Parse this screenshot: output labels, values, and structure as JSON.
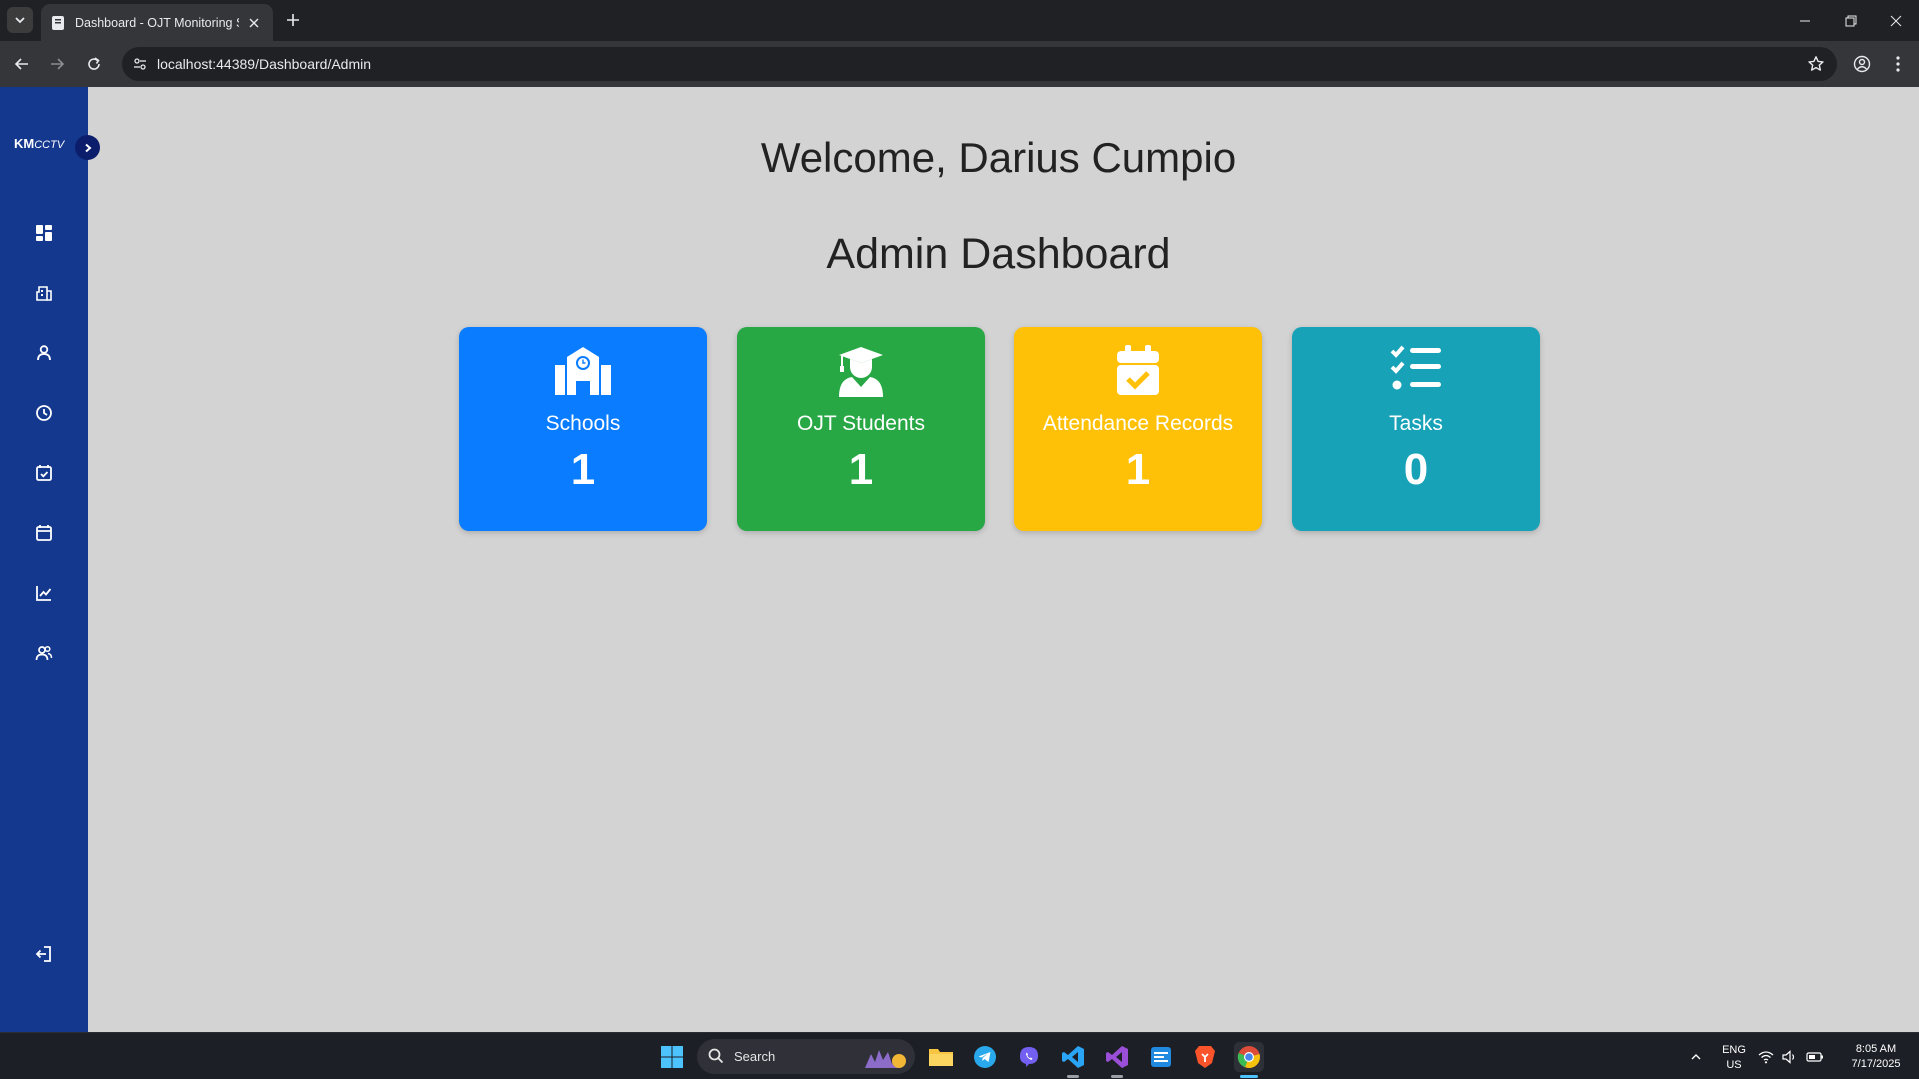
{
  "browser": {
    "tab_title": "Dashboard - OJT Monitoring Sy",
    "url": "localhost:44389/Dashboard/Admin"
  },
  "sidebar": {
    "logo_bold": "KM",
    "logo_italic": "CCTV",
    "items": [
      {
        "icon": "grid-dashboard-icon"
      },
      {
        "icon": "school-building-icon"
      },
      {
        "icon": "user-icon"
      },
      {
        "icon": "clock-icon"
      },
      {
        "icon": "calendar-check-icon"
      },
      {
        "icon": "calendar-icon"
      },
      {
        "icon": "line-chart-icon"
      },
      {
        "icon": "users-icon"
      }
    ],
    "logout_icon": "logout-icon"
  },
  "main": {
    "welcome": "Welcome, Darius Cumpio",
    "title": "Admin Dashboard"
  },
  "cards": [
    {
      "label": "Schools",
      "value": "1",
      "color": "#0a7cff",
      "icon": "school-icon"
    },
    {
      "label": "OJT Students",
      "value": "1",
      "color": "#28a745",
      "icon": "graduate-icon"
    },
    {
      "label": "Attendance Records",
      "value": "1",
      "color": "#ffc107",
      "icon": "calendar-check-icon"
    },
    {
      "label": "Tasks",
      "value": "0",
      "color": "#17a2b8",
      "icon": "checklist-icon"
    }
  ],
  "taskbar": {
    "search_placeholder": "Search",
    "lang_top": "ENG",
    "lang_bottom": "US",
    "time": "8:05 AM",
    "date": "7/17/2025"
  }
}
